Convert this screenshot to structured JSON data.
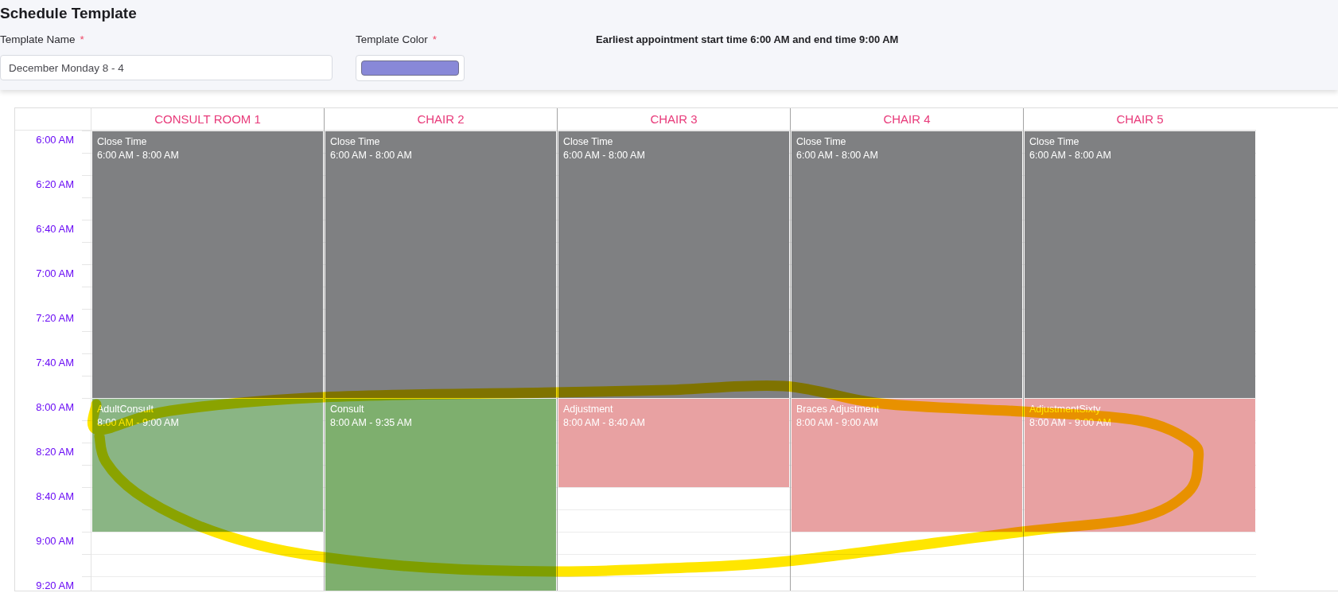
{
  "page": {
    "title": "Schedule Template"
  },
  "form": {
    "fields": [
      {
        "kind": "text",
        "label": "Template Name",
        "required_mark": "*",
        "value": "December Monday 8 - 4"
      },
      {
        "kind": "color",
        "label": "Template Color",
        "required_mark": "*",
        "color": "#8888d8"
      }
    ],
    "note": "Earliest appointment start time 6:00 AM and end time 9:00 AM"
  },
  "schedule": {
    "times": [
      "6:00 AM",
      "6:20 AM",
      "6:40 AM",
      "7:00 AM",
      "7:20 AM",
      "7:40 AM",
      "8:00 AM",
      "8:20 AM",
      "8:40 AM",
      "9:00 AM",
      "9:20 AM"
    ],
    "columns": [
      {
        "title": "CONSULT ROOM 1",
        "events": [
          {
            "title": "Close Time",
            "time": "6:00 AM - 8:00 AM",
            "color": "#7f8082"
          },
          {
            "title": "AdultConsult",
            "time": "8:00 AM - 9:00 AM",
            "color": "#8ab584"
          }
        ]
      },
      {
        "title": "CHAIR 2",
        "events": [
          {
            "title": "Close Time",
            "time": "6:00 AM - 8:00 AM",
            "color": "#7f8082"
          },
          {
            "title": "Consult",
            "time": "8:00 AM - 9:35 AM",
            "color": "#7eaf6e"
          }
        ]
      },
      {
        "title": "CHAIR 3",
        "events": [
          {
            "title": "Close Time",
            "time": "6:00 AM - 8:00 AM",
            "color": "#7f8082"
          },
          {
            "title": "Adjustment",
            "time": "8:00 AM - 8:40 AM",
            "color": "#e8a1a2"
          }
        ]
      },
      {
        "title": "CHAIR 4",
        "events": [
          {
            "title": "Close Time",
            "time": "6:00 AM - 8:00 AM",
            "color": "#7f8082"
          },
          {
            "title": "Braces Adjustment",
            "time": "8:00 AM - 9:00 AM",
            "color": "#e8a1a2"
          }
        ]
      },
      {
        "title": "CHAIR 5",
        "events": [
          {
            "title": "Close Time",
            "time": "6:00 AM - 8:00 AM",
            "color": "#7f8082"
          },
          {
            "title": "AdjustmentSixty",
            "time": "8:00 AM - 9:00 AM",
            "color": "#e8a1a2"
          }
        ]
      }
    ]
  },
  "annotation": {
    "kind": "highlighter-loop"
  }
}
